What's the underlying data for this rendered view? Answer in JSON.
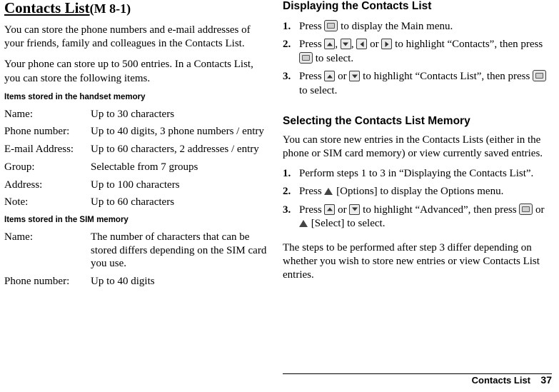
{
  "left": {
    "title": "Contacts List",
    "title_suffix": "(M 8-1)",
    "para1": "You can store the phone numbers and e-mail addresses of your friends, family and colleagues in the Contacts List.",
    "para2": "Your phone can store up to 500 entries. In a Contacts List, you can store the following items.",
    "handset_label": "Items stored in the handset memory",
    "handset_rows": [
      {
        "key": "Name:",
        "value": "Up to 30 characters"
      },
      {
        "key": "Phone number:",
        "value": "Up to 40 digits, 3 phone numbers / entry"
      },
      {
        "key": "E-mail Address:",
        "value": "Up to 60 characters, 2 addresses / entry"
      },
      {
        "key": "Group:",
        "value": "Selectable from 7 groups"
      },
      {
        "key": "Address:",
        "value": "Up to 100 characters"
      },
      {
        "key": "Note:",
        "value": "Up to 60 characters"
      }
    ],
    "sim_label": "Items stored in the SIM memory",
    "sim_rows": [
      {
        "key": "Name:",
        "value": "The number of characters that can be stored differs depending on the SIM card you use."
      },
      {
        "key": "Phone number:",
        "value": "Up to 40 digits"
      }
    ]
  },
  "right": {
    "heading1": "Displaying the Contacts List",
    "steps1": [
      {
        "num": "1.",
        "pre": "Press",
        "mid": "",
        "post": "to display the Main menu."
      },
      {
        "num": "2.",
        "pre": "Press",
        "mid": ",",
        "post": "to highlight “Contacts”, then press"
      },
      {
        "num": "3.",
        "pre": "Press",
        "mid": "or",
        "post": "to highlight “Contacts List”, then press"
      }
    ],
    "step2_tail": "to select.",
    "step3_tail": "to select.",
    "step2_or": "or",
    "heading2": "Selecting the Contacts List Memory",
    "para1": "You can store new entries in the Contacts Lists (either in the phone or SIM card memory) or view currently saved entries.",
    "steps2": [
      {
        "num": "1.",
        "text": "Perform steps 1 to 3 in “Displaying the Contacts List”."
      },
      {
        "num": "2.",
        "pre": "Press",
        "post": "[Options] to display the Options menu.",
        "bracket": "[Options]"
      },
      {
        "num": "3.",
        "pre": "Press",
        "mid": "or",
        "post": "to highlight “Advanced”, then press",
        "tail_or": "or",
        "tail": "[Select] to select.",
        "bracket": "[Select]"
      }
    ],
    "para2": "The steps to be performed after step 3 differ depending on whether you wish to store new entries or view Contacts List entries."
  },
  "footer": {
    "text": "Contacts List",
    "page": "37"
  }
}
